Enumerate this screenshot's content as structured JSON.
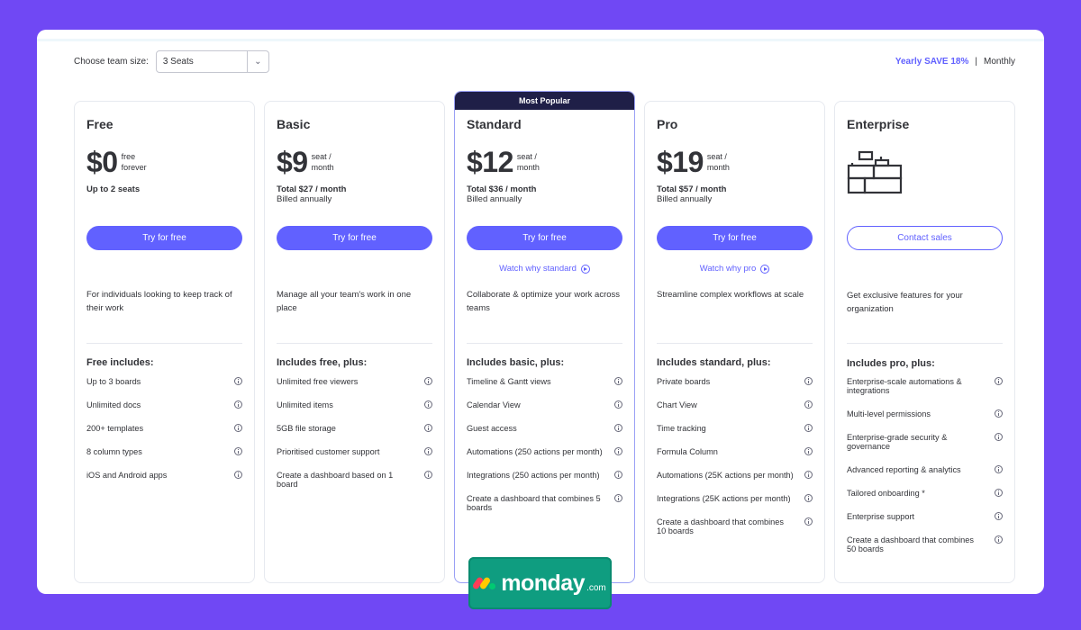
{
  "toolbar": {
    "team_size_label": "Choose team size:",
    "team_size_value": "3 Seats",
    "billing_yearly": "Yearly SAVE 18%",
    "billing_separator": "|",
    "billing_monthly": "Monthly"
  },
  "colors": {
    "accent": "#6161ff",
    "background": "#7048f4",
    "banner": "#1f1f47",
    "logo_bg": "#0f9d80"
  },
  "plans": [
    {
      "name": "Free",
      "price": "$0",
      "price_unit_1": "free",
      "price_unit_2": "forever",
      "sub_bold": "Up to 2 seats",
      "sub_line": "",
      "cta": "Try for free",
      "watch": "",
      "description": "For individuals looking to keep track of their work",
      "includes_title": "Free includes:",
      "features": [
        "Up to 3 boards",
        "Unlimited docs",
        "200+ templates",
        "8 column types",
        "iOS and Android apps"
      ]
    },
    {
      "name": "Basic",
      "price": "$9",
      "price_unit_1": "seat /",
      "price_unit_2": "month",
      "sub_bold": "Total $27 / month",
      "sub_line": "Billed annually",
      "cta": "Try for free",
      "watch": "",
      "description": "Manage all your team's work in one place",
      "includes_title": "Includes free, plus:",
      "features": [
        "Unlimited free viewers",
        "Unlimited items",
        "5GB file storage",
        "Prioritised customer support",
        "Create a dashboard based on 1 board"
      ]
    },
    {
      "name": "Standard",
      "badge": "Most Popular",
      "price": "$12",
      "price_unit_1": "seat /",
      "price_unit_2": "month",
      "sub_bold": "Total $36 / month",
      "sub_line": "Billed annually",
      "cta": "Try for free",
      "watch": "Watch why standard",
      "description": "Collaborate & optimize your work across teams",
      "includes_title": "Includes basic, plus:",
      "features": [
        "Timeline & Gantt views",
        "Calendar View",
        "Guest access",
        "Automations (250 actions per month)",
        "Integrations (250 actions per month)",
        "Create a dashboard that combines 5 boards"
      ]
    },
    {
      "name": "Pro",
      "price": "$19",
      "price_unit_1": "seat /",
      "price_unit_2": "month",
      "sub_bold": "Total $57 / month",
      "sub_line": "Billed annually",
      "cta": "Try for free",
      "watch": "Watch why pro",
      "description": "Streamline complex workflows at scale",
      "includes_title": "Includes standard, plus:",
      "features": [
        "Private boards",
        "Chart View",
        "Time tracking",
        "Formula Column",
        "Automations (25K actions per month)",
        "Integrations (25K actions per month)",
        "Create a dashboard that combines 10 boards"
      ]
    },
    {
      "name": "Enterprise",
      "icon": "building-blocks-icon",
      "cta": "Contact sales",
      "description": "Get exclusive features for your organization",
      "includes_title": "Includes pro, plus:",
      "features": [
        "Enterprise-scale automations & integrations",
        "Multi-level permissions",
        "Enterprise-grade security & governance",
        "Advanced reporting & analytics",
        "Tailored onboarding *",
        "Enterprise support",
        "Create a dashboard that combines 50 boards"
      ]
    }
  ],
  "logo": {
    "text": "monday",
    "suffix": ".com"
  }
}
